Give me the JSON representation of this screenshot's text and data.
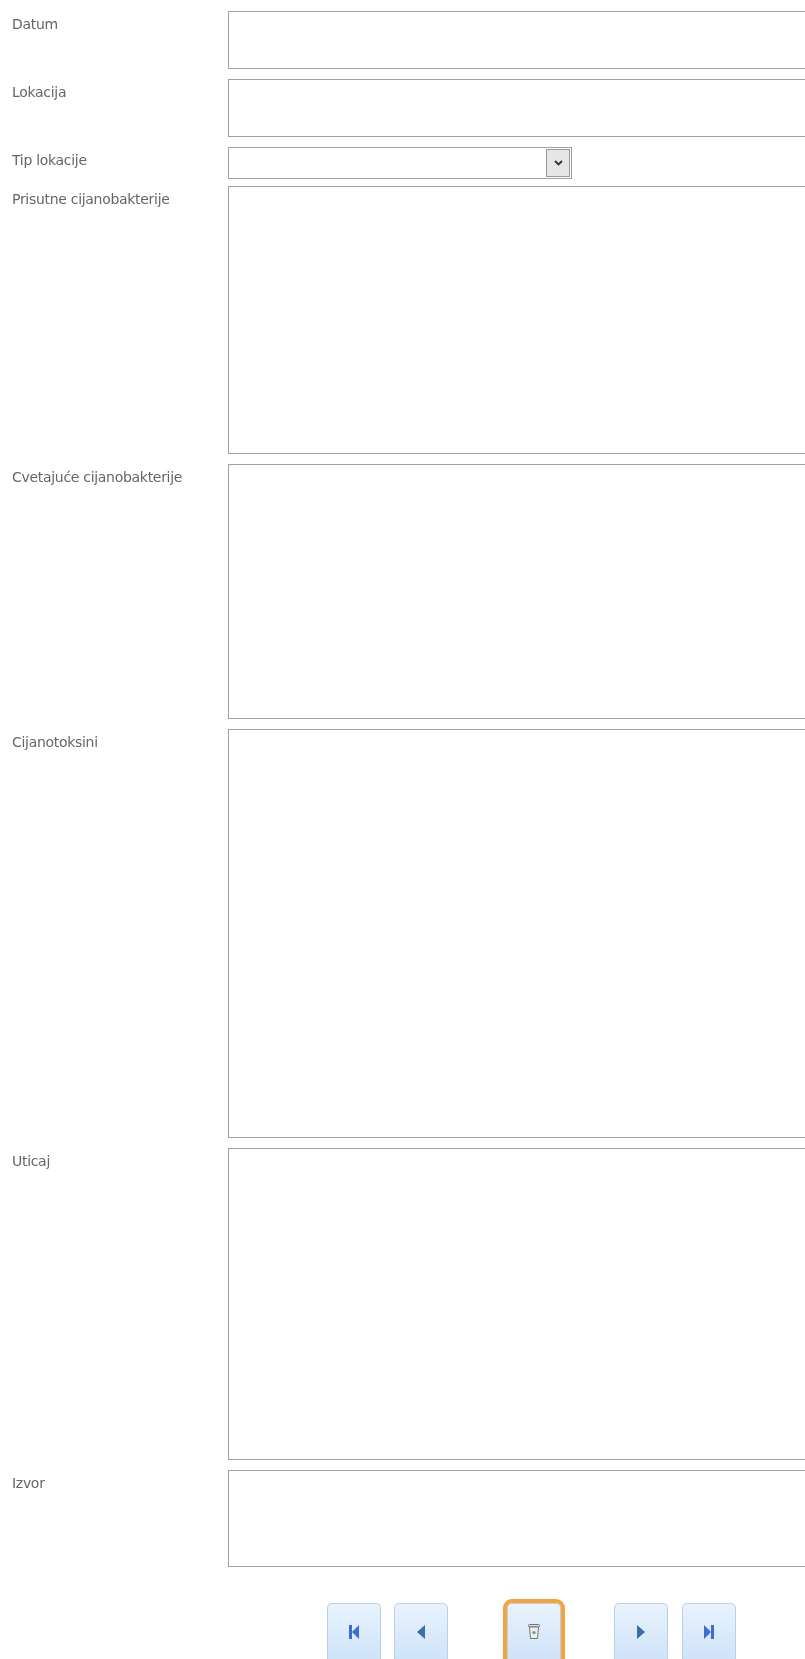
{
  "fields": [
    {
      "label": "Datum",
      "kind": "text"
    },
    {
      "label": "Lokacija",
      "kind": "text"
    },
    {
      "label": "Tip lokacije",
      "kind": "combo"
    },
    {
      "label": "Prisutne cijanobakterije",
      "kind": "memo"
    },
    {
      "label": "Cvetajuće cijanobakterije",
      "kind": "memo"
    },
    {
      "label": "Cijanotoksini",
      "kind": "memo"
    },
    {
      "label": "Uticaj",
      "kind": "memo"
    },
    {
      "label": "Izvor",
      "kind": "memo"
    }
  ],
  "nav_buttons": [
    {
      "kind": "first",
      "focused": false
    },
    {
      "kind": "prev",
      "focused": false
    },
    {
      "kind": "delete",
      "focused": true
    },
    {
      "kind": "next",
      "focused": false
    },
    {
      "kind": "last",
      "focused": false
    }
  ]
}
